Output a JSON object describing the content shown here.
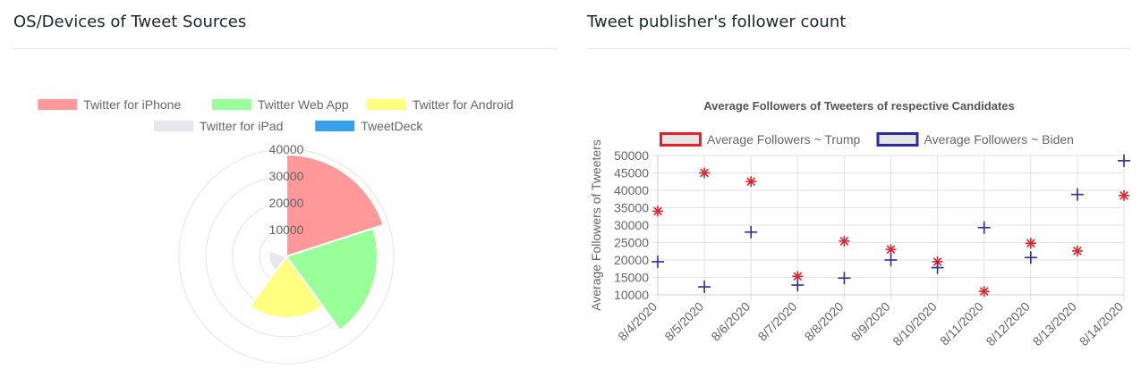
{
  "panels": {
    "left_title": "OS/Devices of Tweet Sources",
    "right_title": "Tweet publisher's follower count"
  },
  "chart_data": [
    {
      "type": "polarArea",
      "title": "",
      "legend_position": "top",
      "categories": [
        "Twitter for iPhone",
        "Twitter Web App",
        "Twitter for Android",
        "Twitter for iPad",
        "TweetDeck"
      ],
      "values": [
        38000,
        34000,
        23000,
        6500,
        300
      ],
      "colors": [
        "#ff9999",
        "#99ff99",
        "#ffff80",
        "#e6e6ec",
        "#36a2eb"
      ],
      "r_ticks": [
        "10000",
        "20000",
        "30000",
        "40000"
      ],
      "r_max": 40000
    },
    {
      "type": "scatter",
      "title": "Average Followers of Tweeters of respective Candidates",
      "ylabel": "Average Followers of Tweeters",
      "xlabel": "",
      "legend_position": "top",
      "categories": [
        "8/4/2020",
        "8/5/2020",
        "8/6/2020",
        "8/7/2020",
        "8/8/2020",
        "8/9/2020",
        "8/10/2020",
        "8/11/2020",
        "8/12/2020",
        "8/13/2020",
        "8/14/2020"
      ],
      "y_ticks": [
        "10000",
        "15000",
        "20000",
        "25000",
        "30000",
        "35000",
        "40000",
        "45000",
        "50000"
      ],
      "ylim": [
        10000,
        50000
      ],
      "series": [
        {
          "name": "Average Followers ~ Trump",
          "color": "#e8202a",
          "marker": "star",
          "values": [
            34000,
            45000,
            42500,
            15300,
            25400,
            23000,
            19500,
            11000,
            24800,
            22600,
            38500
          ]
        },
        {
          "name": "Average Followers ~ Biden",
          "color": "#2b2d9e",
          "marker": "cross",
          "values": [
            19500,
            12300,
            28000,
            12800,
            14800,
            20000,
            17800,
            29300,
            20700,
            38800,
            48500
          ]
        }
      ]
    }
  ]
}
